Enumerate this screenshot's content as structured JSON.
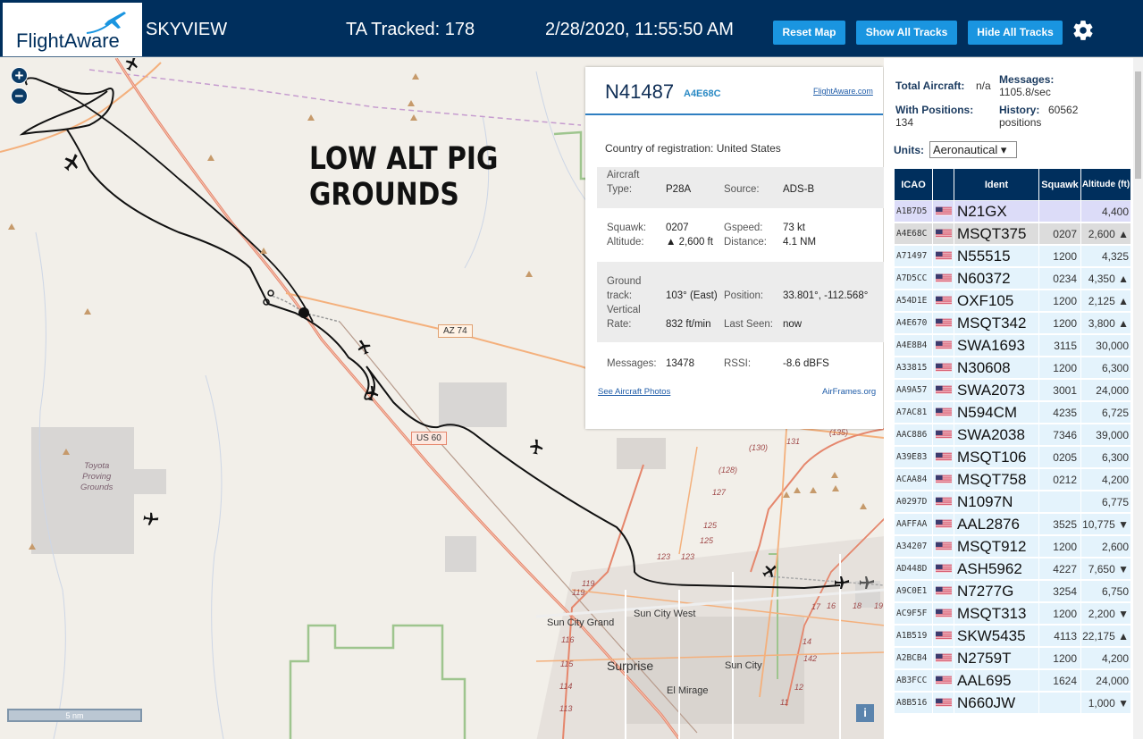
{
  "header": {
    "logo_text": "FlightAware",
    "app_name": "SKYVIEW",
    "tracked": "TA Tracked: 178",
    "datetime": "2/28/2020, 11:55:50 AM",
    "reset_map": "Reset Map",
    "show_all_tracks": "Show All Tracks",
    "hide_all_tracks": "Hide All Tracks",
    "settings_icon": "gear-icon"
  },
  "map": {
    "zoom_in": "+",
    "zoom_out": "−",
    "annotation_line1": "LOW ALT PIG",
    "annotation_line2": "GROUNDS",
    "scale": "5 nm",
    "info": "i",
    "labels": {
      "toyota": [
        "Toyota",
        "Proving",
        "Grounds"
      ],
      "az74": "AZ 74",
      "us60": "US 60",
      "sun_city_grand": "Sun City Grand",
      "sun_city_west": "Sun City West",
      "sun_city": "Sun City",
      "surprise": "Surprise",
      "el_mirage": "El Mirage",
      "route_numbers": [
        "(130)",
        "131",
        "(128)",
        "127",
        "125",
        "125",
        "123",
        "123",
        "119",
        "119",
        "116",
        "115",
        "114",
        "113",
        "142",
        "14",
        "12",
        "11",
        "17",
        "16",
        "18",
        "19",
        "(135)"
      ]
    }
  },
  "popup": {
    "registration": "N41487",
    "hex": "A4E68C",
    "flightaware_link": "FlightAware.com",
    "country_label": "Country of registration:",
    "country": "United States",
    "aircraft_type_label": [
      "Aircraft",
      "Type:"
    ],
    "aircraft_type": "P28A",
    "source_label": "Source:",
    "source": "ADS-B",
    "squawk_label": "Squawk:",
    "squawk": "0207",
    "gspeed_label": "Gspeed:",
    "gspeed": "73 kt",
    "altitude_label": "Altitude:",
    "altitude": "▲ 2,600 ft",
    "distance_label": "Distance:",
    "distance": "4.1 NM",
    "ground_track_label": [
      "Ground",
      "track:"
    ],
    "ground_track": "103° (East)",
    "position_label": "Position:",
    "position": "33.801°, -112.568°",
    "vertical_rate_label": [
      "Vertical",
      "Rate:"
    ],
    "vertical_rate": "832 ft/min",
    "last_seen_label": "Last Seen:",
    "last_seen": "now",
    "messages_label": "Messages:",
    "messages": "13478",
    "rssi_label": "RSSI:",
    "rssi": "-8.6 dBFS",
    "photos_link": "See Aircraft Photos",
    "airframes_link": "AirFrames.org"
  },
  "sidebar": {
    "total_aircraft_label": "Total Aircraft:",
    "total_aircraft": "n/a",
    "messages_label": "Messages:",
    "messages_rate": "1105.8/sec",
    "with_positions_label": "With Positions:",
    "with_positions": "134",
    "history_label": "History:",
    "history_value": "60562",
    "history_unit": "positions",
    "units_label": "Units:",
    "units_value": "Aeronautical ▾",
    "columns": [
      "ICAO",
      "",
      "Ident",
      "Squawk",
      "Altitude (ft)"
    ],
    "rows": [
      {
        "icao": "A1B7D5",
        "ident": "N21GX",
        "squawk": "",
        "alt": "4,400"
      },
      {
        "icao": "A4E68C",
        "ident": "MSQT375",
        "squawk": "0207",
        "alt": "2,600 ▲"
      },
      {
        "icao": "A71497",
        "ident": "N55515",
        "squawk": "1200",
        "alt": "4,325"
      },
      {
        "icao": "A7D5CC",
        "ident": "N60372",
        "squawk": "0234",
        "alt": "4,350 ▲"
      },
      {
        "icao": "A54D1E",
        "ident": "OXF105",
        "squawk": "1200",
        "alt": "2,125 ▲"
      },
      {
        "icao": "A4E670",
        "ident": "MSQT342",
        "squawk": "1200",
        "alt": "3,800 ▲"
      },
      {
        "icao": "A4E8B4",
        "ident": "SWA1693",
        "squawk": "3115",
        "alt": "30,000"
      },
      {
        "icao": "A33815",
        "ident": "N30608",
        "squawk": "1200",
        "alt": "6,300"
      },
      {
        "icao": "AA9A57",
        "ident": "SWA2073",
        "squawk": "3001",
        "alt": "24,000"
      },
      {
        "icao": "A7AC81",
        "ident": "N594CM",
        "squawk": "4235",
        "alt": "6,725"
      },
      {
        "icao": "AAC886",
        "ident": "SWA2038",
        "squawk": "7346",
        "alt": "39,000"
      },
      {
        "icao": "A39E83",
        "ident": "MSQT106",
        "squawk": "0205",
        "alt": "6,300"
      },
      {
        "icao": "ACAA84",
        "ident": "MSQT758",
        "squawk": "0212",
        "alt": "4,200"
      },
      {
        "icao": "A0297D",
        "ident": "N1097N",
        "squawk": "",
        "alt": "6,775"
      },
      {
        "icao": "AAFFAA",
        "ident": "AAL2876",
        "squawk": "3525",
        "alt": "10,775 ▼"
      },
      {
        "icao": "A34207",
        "ident": "MSQT912",
        "squawk": "1200",
        "alt": "2,600"
      },
      {
        "icao": "AD448D",
        "ident": "ASH5962",
        "squawk": "4227",
        "alt": "7,650 ▼"
      },
      {
        "icao": "A9C0E1",
        "ident": "N7277G",
        "squawk": "3254",
        "alt": "6,750"
      },
      {
        "icao": "AC9F5F",
        "ident": "MSQT313",
        "squawk": "1200",
        "alt": "2,200 ▼"
      },
      {
        "icao": "A1B519",
        "ident": "SKW5435",
        "squawk": "4113",
        "alt": "22,175 ▲"
      },
      {
        "icao": "A2BCB4",
        "ident": "N2759T",
        "squawk": "1200",
        "alt": "4,200"
      },
      {
        "icao": "AB3FCC",
        "ident": "AAL695",
        "squawk": "1624",
        "alt": "24,000"
      },
      {
        "icao": "A8B516",
        "ident": "N660JW",
        "squawk": "",
        "alt": "1,000 ▼"
      }
    ]
  },
  "colors": {
    "header_bg": "#002f5d",
    "button_blue": "#1a95e0",
    "table_row": "#e4f3fc",
    "selected_row": "#dcdcdc"
  }
}
